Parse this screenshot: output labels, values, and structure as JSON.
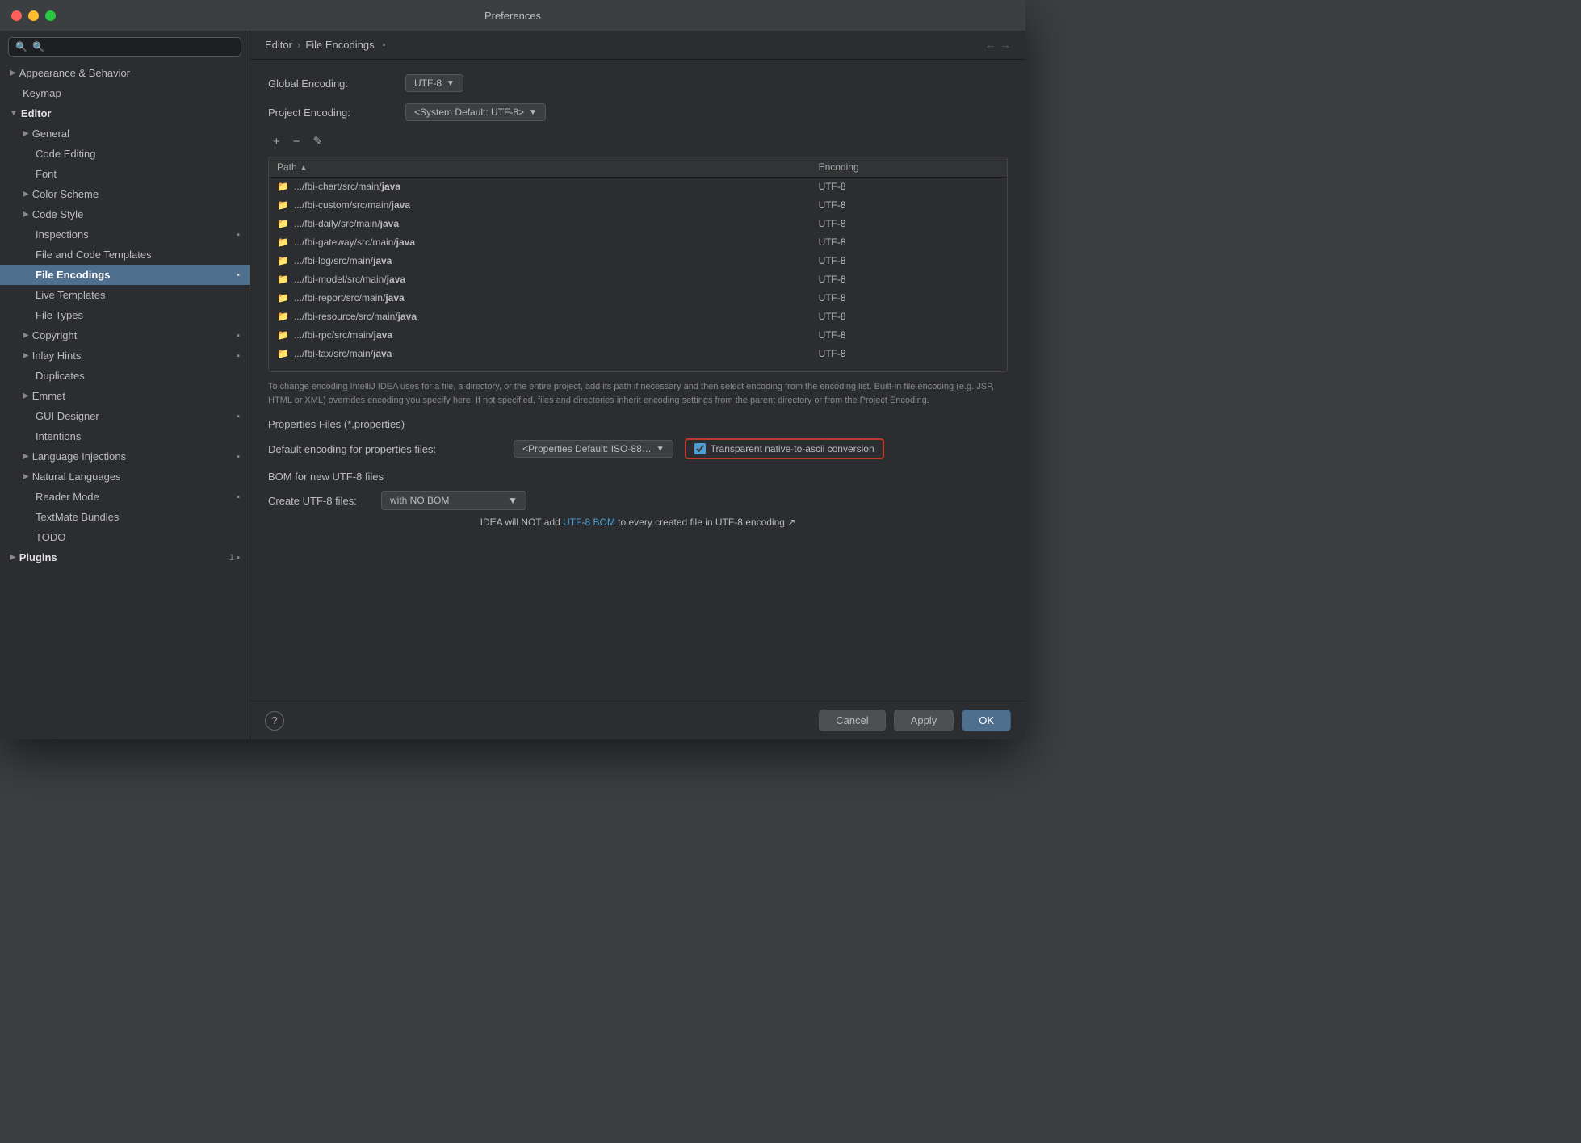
{
  "window": {
    "title": "Preferences"
  },
  "sidebar": {
    "search_placeholder": "🔍",
    "items": [
      {
        "id": "appearance-behavior",
        "label": "Appearance & Behavior",
        "indent": 0,
        "type": "section-collapsed",
        "chevron": "▶"
      },
      {
        "id": "keymap",
        "label": "Keymap",
        "indent": 0,
        "type": "item"
      },
      {
        "id": "editor",
        "label": "Editor",
        "indent": 0,
        "type": "section-expanded",
        "chevron": "▼"
      },
      {
        "id": "general",
        "label": "General",
        "indent": 1,
        "type": "collapsed",
        "chevron": "▶"
      },
      {
        "id": "code-editing",
        "label": "Code Editing",
        "indent": 2,
        "type": "item"
      },
      {
        "id": "font",
        "label": "Font",
        "indent": 2,
        "type": "item"
      },
      {
        "id": "color-scheme",
        "label": "Color Scheme",
        "indent": 1,
        "type": "collapsed",
        "chevron": "▶"
      },
      {
        "id": "code-style",
        "label": "Code Style",
        "indent": 1,
        "type": "collapsed",
        "chevron": "▶"
      },
      {
        "id": "inspections",
        "label": "Inspections",
        "indent": 1,
        "type": "item",
        "badge": "▪"
      },
      {
        "id": "file-code-templates",
        "label": "File and Code Templates",
        "indent": 1,
        "type": "item"
      },
      {
        "id": "file-encodings",
        "label": "File Encodings",
        "indent": 1,
        "type": "item",
        "active": true,
        "badge": "▪"
      },
      {
        "id": "live-templates",
        "label": "Live Templates",
        "indent": 1,
        "type": "item"
      },
      {
        "id": "file-types",
        "label": "File Types",
        "indent": 1,
        "type": "item"
      },
      {
        "id": "copyright",
        "label": "Copyright",
        "indent": 1,
        "type": "collapsed",
        "chevron": "▶",
        "badge": "▪"
      },
      {
        "id": "inlay-hints",
        "label": "Inlay Hints",
        "indent": 1,
        "type": "collapsed",
        "chevron": "▶",
        "badge": "▪"
      },
      {
        "id": "duplicates",
        "label": "Duplicates",
        "indent": 1,
        "type": "item"
      },
      {
        "id": "emmet",
        "label": "Emmet",
        "indent": 1,
        "type": "collapsed",
        "chevron": "▶"
      },
      {
        "id": "gui-designer",
        "label": "GUI Designer",
        "indent": 1,
        "type": "item",
        "badge": "▪"
      },
      {
        "id": "intentions",
        "label": "Intentions",
        "indent": 1,
        "type": "item"
      },
      {
        "id": "language-injections",
        "label": "Language Injections",
        "indent": 1,
        "type": "collapsed",
        "chevron": "▶",
        "badge": "▪"
      },
      {
        "id": "natural-languages",
        "label": "Natural Languages",
        "indent": 1,
        "type": "collapsed",
        "chevron": "▶"
      },
      {
        "id": "reader-mode",
        "label": "Reader Mode",
        "indent": 1,
        "type": "item",
        "badge": "▪"
      },
      {
        "id": "textmate-bundles",
        "label": "TextMate Bundles",
        "indent": 1,
        "type": "item"
      },
      {
        "id": "todo",
        "label": "TODO",
        "indent": 1,
        "type": "item"
      },
      {
        "id": "plugins",
        "label": "Plugins",
        "indent": 0,
        "type": "section-collapsed",
        "chevron": "▶",
        "badge": "1 ▪"
      }
    ]
  },
  "breadcrumb": {
    "parent": "Editor",
    "separator": "›",
    "current": "File Encodings",
    "icon": "▪"
  },
  "content": {
    "global_encoding_label": "Global Encoding:",
    "global_encoding_value": "UTF-8",
    "project_encoding_label": "Project Encoding:",
    "project_encoding_value": "<System Default: UTF-8>",
    "toolbar": {
      "add": "+",
      "remove": "−",
      "edit": "✎"
    },
    "table": {
      "columns": [
        {
          "id": "path",
          "label": "Path",
          "sort": "▲"
        },
        {
          "id": "encoding",
          "label": "Encoding"
        }
      ],
      "rows": [
        {
          "path": ".../fbi-chart/src/main/java",
          "bold_part": "java",
          "encoding": "UTF-8"
        },
        {
          "path": ".../fbi-custom/src/main/java",
          "bold_part": "java",
          "encoding": "UTF-8"
        },
        {
          "path": ".../fbi-daily/src/main/java",
          "bold_part": "java",
          "encoding": "UTF-8"
        },
        {
          "path": ".../fbi-gateway/src/main/java",
          "bold_part": "java",
          "encoding": "UTF-8"
        },
        {
          "path": ".../fbi-log/src/main/java",
          "bold_part": "java",
          "encoding": "UTF-8"
        },
        {
          "path": ".../fbi-model/src/main/java",
          "bold_part": "java",
          "encoding": "UTF-8"
        },
        {
          "path": ".../fbi-report/src/main/java",
          "bold_part": "java",
          "encoding": "UTF-8"
        },
        {
          "path": ".../fbi-resource/src/main/java",
          "bold_part": "java",
          "encoding": "UTF-8"
        },
        {
          "path": ".../fbi-rpc/src/main/java",
          "bold_part": "java",
          "encoding": "UTF-8"
        },
        {
          "path": ".../fbi-tax/src/main/java",
          "bold_part": "java",
          "encoding": "UTF-8"
        }
      ]
    },
    "info_text": "To change encoding IntelliJ IDEA uses for a file, a directory, or the entire project, add its path if necessary and then select encoding from the encoding list. Built-in file encoding (e.g. JSP, HTML or XML) overrides encoding you specify here. If not specified, files and directories inherit encoding settings from the parent directory or from the Project Encoding.",
    "properties_section": {
      "title": "Properties Files (*.properties)",
      "default_encoding_label": "Default encoding for properties files:",
      "default_encoding_value": "<Properties Default: ISO-88…",
      "transparent_checkbox_label": "Transparent native-to-ascii conversion",
      "transparent_checked": true
    },
    "bom_section": {
      "title": "BOM for new UTF-8 files",
      "create_label": "Create UTF-8 files:",
      "create_value": "with NO BOM",
      "info_text_prefix": "IDEA will NOT add ",
      "info_link": "UTF-8 BOM",
      "info_text_suffix": " to every created file in UTF-8 encoding ↗"
    }
  },
  "bottom_bar": {
    "help_label": "?",
    "cancel_label": "Cancel",
    "apply_label": "Apply",
    "ok_label": "OK"
  },
  "colors": {
    "active_item_bg": "#4e6f8e",
    "link_color": "#4e9fd5",
    "highlight_border": "#c0392b",
    "folder_icon": "#5b9bd5"
  }
}
